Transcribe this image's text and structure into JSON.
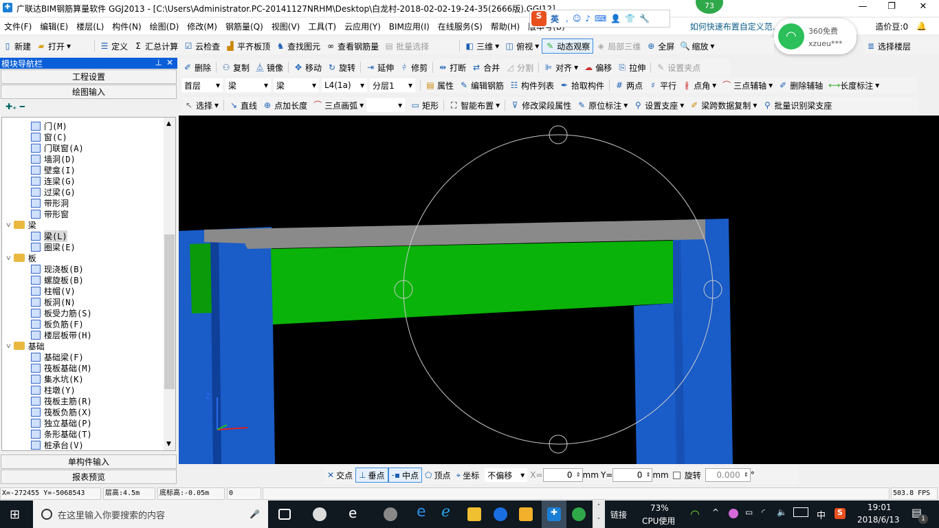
{
  "window": {
    "title": "广联达BIM钢筋算量软件 GGJ2013 - [C:\\Users\\Administrator.PC-20141127NRHM\\Desktop\\白龙村-2018-02-02-19-24-35(2666版).GGJ12]",
    "badge": "73"
  },
  "menu": [
    "文件(F)",
    "编辑(E)",
    "楼层(L)",
    "构件(N)",
    "绘图(D)",
    "修改(M)",
    "钢筋量(Q)",
    "视图(V)",
    "工具(T)",
    "云应用(Y)",
    "BIM应用(I)",
    "在线服务(S)",
    "帮助(H)",
    "版本号(B)"
  ],
  "menu_extra": {
    "news": "如何快速布置自定义范..",
    "coins": "造价豆:0"
  },
  "ime": {
    "lang": "英"
  },
  "wifi_popup": {
    "title": "360免费",
    "ssid": "xzueu***"
  },
  "toolbar1": [
    "新建",
    "打开",
    "定义",
    "汇总计算",
    "云检查",
    "平齐板顶",
    "查找图元",
    "查看钢筋量",
    "批量选择",
    "三维",
    "俯视",
    "动态观察",
    "局部三维",
    "全屏",
    "缩放",
    "选择楼层"
  ],
  "toolbar2": [
    "删除",
    "复制",
    "镜像",
    "移动",
    "旋转",
    "延伸",
    "修剪",
    "打断",
    "合并",
    "分割",
    "对齐",
    "偏移",
    "拉伸",
    "设置夹点"
  ],
  "toolbar3": {
    "dropdowns": [
      "首层",
      "梁",
      "梁",
      "L4(1a)",
      "分层1"
    ],
    "items": [
      "属性",
      "编辑钢筋",
      "构件列表",
      "拾取构件",
      "两点",
      "平行",
      "点角",
      "三点辅轴",
      "删除辅轴",
      "长度标注"
    ]
  },
  "toolbar4": [
    "选择",
    "直线",
    "点加长度",
    "三点画弧",
    "矩形",
    "智能布置",
    "修改梁段属性",
    "原位标注",
    "设置支座",
    "梁跨数据复制",
    "批量识别梁支座"
  ],
  "nav": {
    "title": "模块导航栏",
    "sections": [
      "工程设置",
      "绘图输入",
      "单构件输入",
      "报表预览"
    ]
  },
  "tree": [
    {
      "label": "门(M)",
      "level": 2
    },
    {
      "label": "窗(C)",
      "level": 2
    },
    {
      "label": "门联窗(A)",
      "level": 2
    },
    {
      "label": "墙洞(D)",
      "level": 2
    },
    {
      "label": "壁龛(I)",
      "level": 2
    },
    {
      "label": "连梁(G)",
      "level": 2
    },
    {
      "label": "过梁(G)",
      "level": 2
    },
    {
      "label": "带形洞",
      "level": 2
    },
    {
      "label": "带形窗",
      "level": 2
    },
    {
      "label": "梁",
      "level": 1
    },
    {
      "label": "梁(L)",
      "level": 2,
      "selected": true
    },
    {
      "label": "圈梁(E)",
      "level": 2
    },
    {
      "label": "板",
      "level": 1
    },
    {
      "label": "现浇板(B)",
      "level": 2
    },
    {
      "label": "螺旋板(B)",
      "level": 2
    },
    {
      "label": "柱帽(V)",
      "level": 2
    },
    {
      "label": "板洞(N)",
      "level": 2
    },
    {
      "label": "板受力筋(S)",
      "level": 2
    },
    {
      "label": "板负筋(F)",
      "level": 2
    },
    {
      "label": "楼层板带(H)",
      "level": 2
    },
    {
      "label": "基础",
      "level": 1
    },
    {
      "label": "基础梁(F)",
      "level": 2
    },
    {
      "label": "筏板基础(M)",
      "level": 2
    },
    {
      "label": "集水坑(K)",
      "level": 2
    },
    {
      "label": "柱墩(Y)",
      "level": 2
    },
    {
      "label": "筏板主筋(R)",
      "level": 2
    },
    {
      "label": "筏板负筋(X)",
      "level": 2
    },
    {
      "label": "独立基础(P)",
      "level": 2
    },
    {
      "label": "条形基础(T)",
      "level": 2
    },
    {
      "label": "桩承台(V)",
      "level": 2
    }
  ],
  "snap": {
    "items": [
      "交点",
      "垂点",
      "中点",
      "顶点",
      "坐标"
    ],
    "offset": "不偏移",
    "x_label": "X=",
    "x": "0",
    "y_label": "Y=",
    "y": "0",
    "unit": "mm",
    "rotate_label": "旋转",
    "rotate": "0.000",
    "deg": "°"
  },
  "status": {
    "coords": "X=-272455 Y=-5068543",
    "floor_height": "层高:4.5m",
    "bottom_elev": "底标高:-0.05m",
    "count": "0",
    "fps": "503.8 FPS"
  },
  "taskbar": {
    "search": "在这里输入你要搜索的内容",
    "link": "链接",
    "cpu": "73%",
    "cpu_label": "CPU使用",
    "ime": "中",
    "time": "19:01",
    "date": "2018/6/13",
    "notif": "1"
  },
  "colors": {
    "column": "#1a5cc8",
    "beam_face": "#09b309",
    "beam_top": "#8a8a8a",
    "nav_header": "#0a5fd8"
  }
}
